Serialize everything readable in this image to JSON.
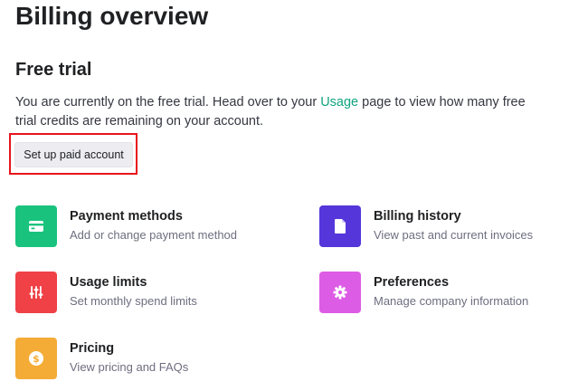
{
  "page": {
    "title": "Billing overview"
  },
  "trial": {
    "heading": "Free trial",
    "desc_before": "You are currently on the free trial. Head over to your ",
    "usage_link": "Usage",
    "desc_after": " page to view how many free trial credits are remaining on your account.",
    "setup_button": "Set up paid account"
  },
  "cards": {
    "payment": {
      "title": "Payment methods",
      "subtitle": "Add or change payment method",
      "icon": "credit-card-icon",
      "color": "#19c37d"
    },
    "history": {
      "title": "Billing history",
      "subtitle": "View past and current invoices",
      "icon": "document-icon",
      "color": "#5436da"
    },
    "limits": {
      "title": "Usage limits",
      "subtitle": "Set monthly spend limits",
      "icon": "sliders-icon",
      "color": "#ef4146"
    },
    "preferences": {
      "title": "Preferences",
      "subtitle": "Manage company information",
      "icon": "gear-icon",
      "color": "#dd5ce5"
    },
    "pricing": {
      "title": "Pricing",
      "subtitle": "View pricing and FAQs",
      "icon": "dollar-coin-icon",
      "color": "#f4ac36"
    }
  }
}
